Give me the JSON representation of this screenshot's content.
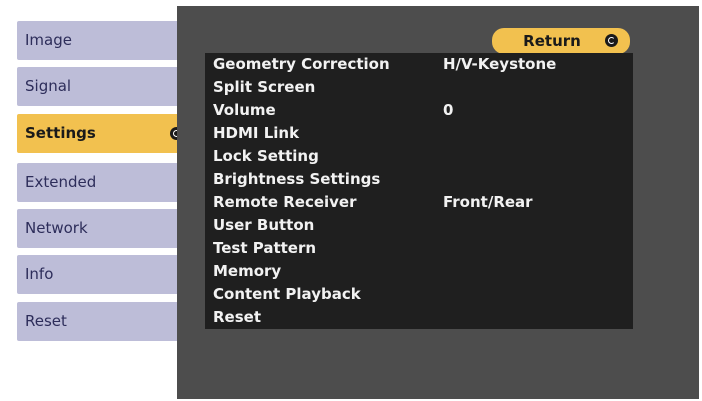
{
  "sidebar": {
    "items": [
      {
        "label": "Image"
      },
      {
        "label": "Signal"
      },
      {
        "label": "Settings"
      },
      {
        "label": "Extended"
      },
      {
        "label": "Network"
      },
      {
        "label": "Info"
      },
      {
        "label": "Reset"
      }
    ],
    "selected": "Settings"
  },
  "panel": {
    "return_label": "Return",
    "rows": [
      {
        "label": "Geometry Correction",
        "value": "H/V-Keystone"
      },
      {
        "label": "Split Screen",
        "value": ""
      },
      {
        "label": "Volume",
        "value": "0"
      },
      {
        "label": "HDMI Link",
        "value": ""
      },
      {
        "label": "Lock Setting",
        "value": ""
      },
      {
        "label": "Brightness Settings",
        "value": ""
      },
      {
        "label": "Remote Receiver",
        "value": "Front/Rear"
      },
      {
        "label": "User Button",
        "value": ""
      },
      {
        "label": "Test Pattern",
        "value": ""
      },
      {
        "label": "Memory",
        "value": ""
      },
      {
        "label": "Content Playback",
        "value": ""
      },
      {
        "label": "Reset",
        "value": ""
      }
    ]
  },
  "colors": {
    "accent": "#f2c14f",
    "sidebar_bg": "#bdbdd8",
    "panel_bg": "#4d4d4d",
    "row_bg": "#1f1f1f"
  }
}
